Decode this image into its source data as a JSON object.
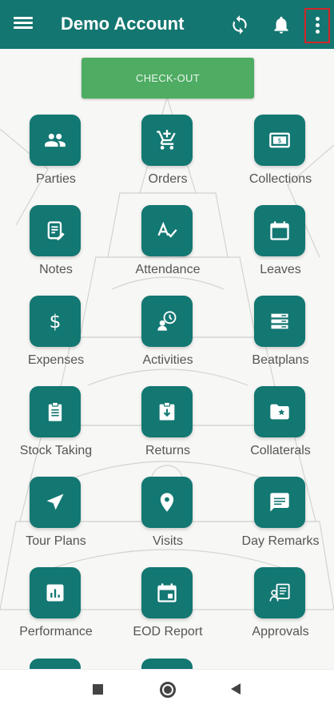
{
  "appbar": {
    "title": "Demo Account"
  },
  "checkout_label": "CHECK-OUT",
  "tiles": [
    {
      "label": "Parties",
      "icon": "parties-icon"
    },
    {
      "label": "Orders",
      "icon": "cart-icon"
    },
    {
      "label": "Collections",
      "icon": "cash-icon"
    },
    {
      "label": "Notes",
      "icon": "note-icon"
    },
    {
      "label": "Attendance",
      "icon": "attendance-icon"
    },
    {
      "label": "Leaves",
      "icon": "calendar-icon"
    },
    {
      "label": "Expenses",
      "icon": "dollar-icon"
    },
    {
      "label": "Activities",
      "icon": "activities-icon"
    },
    {
      "label": "Beatplans",
      "icon": "beatplan-icon"
    },
    {
      "label": "Stock Taking",
      "icon": "clipboard-icon"
    },
    {
      "label": "Returns",
      "icon": "return-icon"
    },
    {
      "label": "Collaterals",
      "icon": "folder-star-icon"
    },
    {
      "label": "Tour Plans",
      "icon": "navigation-icon"
    },
    {
      "label": "Visits",
      "icon": "location-pin-icon"
    },
    {
      "label": "Day Remarks",
      "icon": "comment-icon"
    },
    {
      "label": "Performance",
      "icon": "bar-chart-icon"
    },
    {
      "label": "EOD Report",
      "icon": "event-icon"
    },
    {
      "label": "Approvals",
      "icon": "approvals-icon"
    }
  ],
  "colors": {
    "appbar": "#147670",
    "tile": "#137772",
    "checkout": "#4fac63",
    "highlight": "#d3262a"
  }
}
